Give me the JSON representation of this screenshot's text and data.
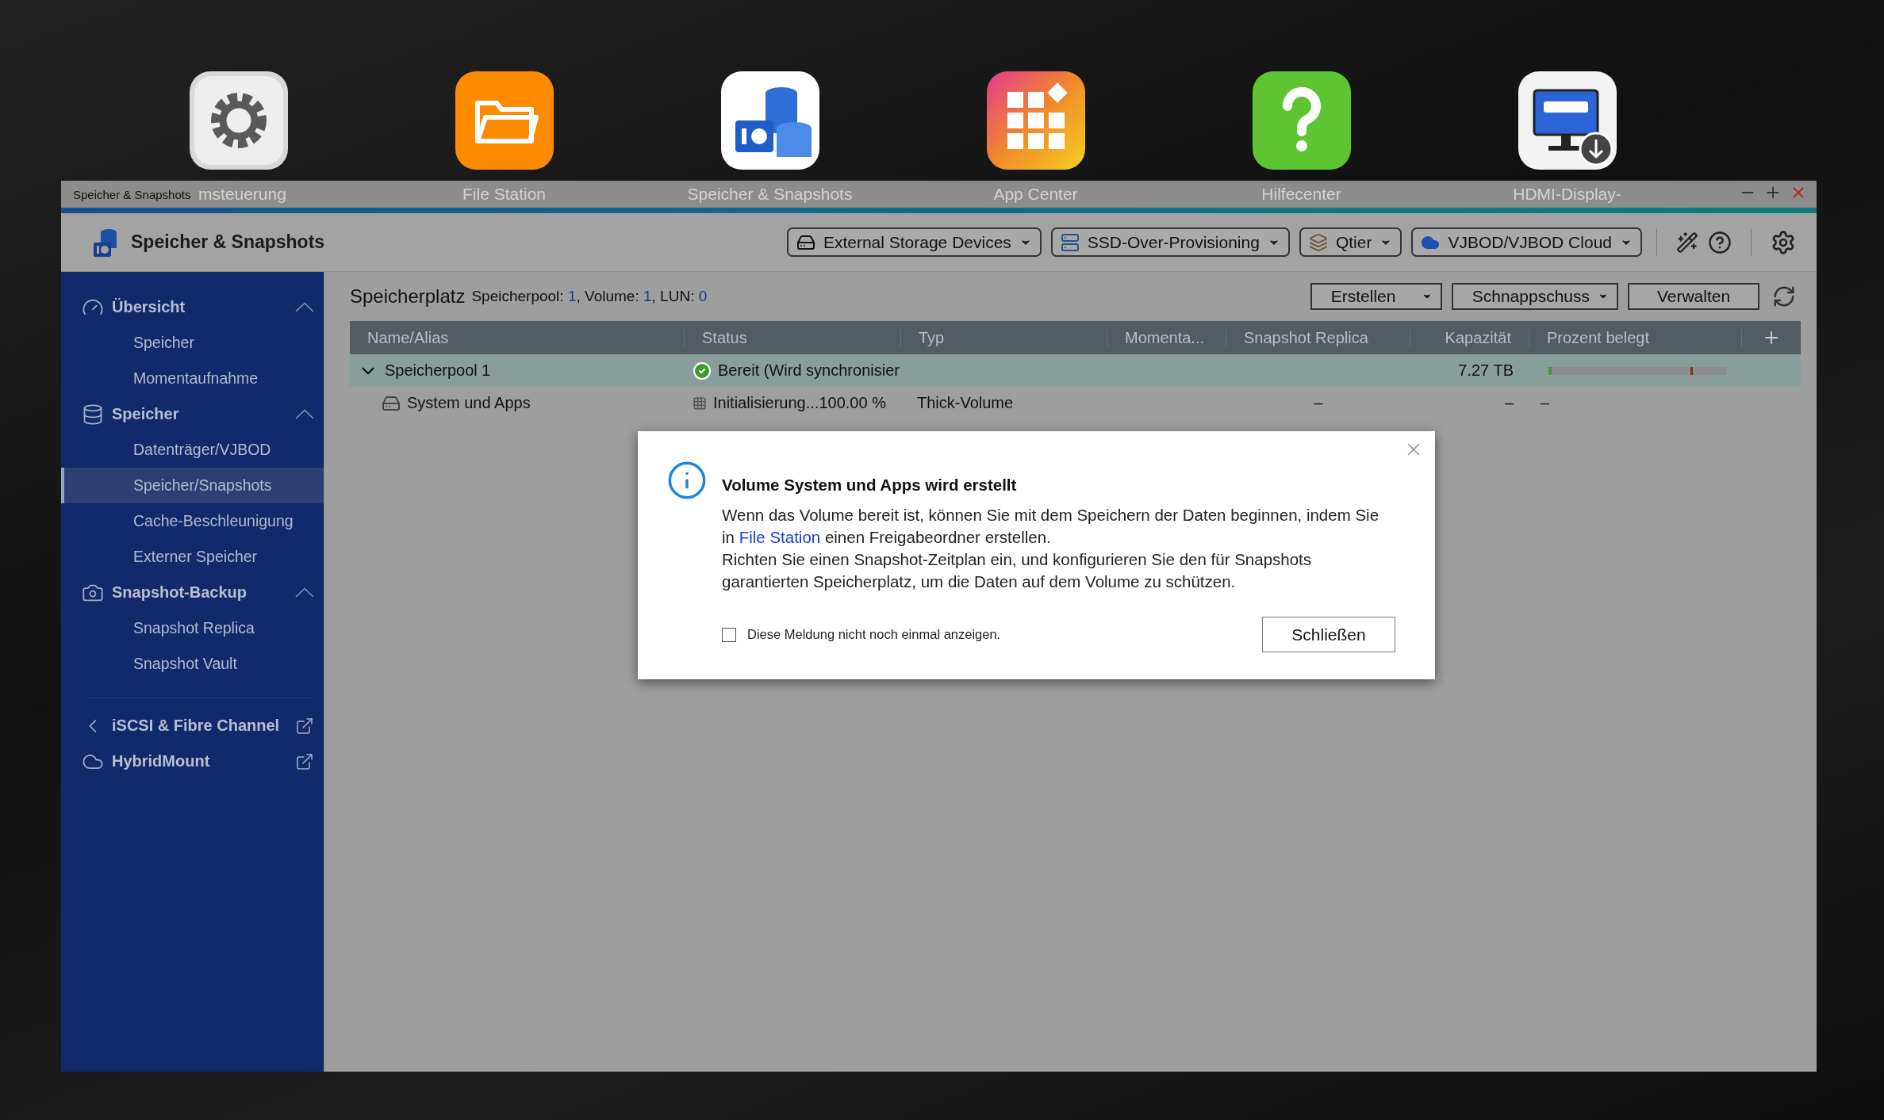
{
  "desktop": {
    "icons": [
      {
        "kind": "settings",
        "label": "msteuerung"
      },
      {
        "kind": "folder",
        "label": "File Station"
      },
      {
        "kind": "storage",
        "label": "Speicher & Snapshots"
      },
      {
        "kind": "apps",
        "label": "App Center"
      },
      {
        "kind": "help",
        "label": "Hilfecenter"
      },
      {
        "kind": "hdmi",
        "label": "HDMI-Display-"
      }
    ]
  },
  "window": {
    "title": "Speicher & Snapshots",
    "app_name": "Speicher & Snapshots",
    "toolbar": [
      {
        "kind": "disk",
        "label": "External Storage Devices"
      },
      {
        "kind": "ssd",
        "label": "SSD-Over-Provisioning"
      },
      {
        "kind": "tier",
        "label": "Qtier"
      },
      {
        "kind": "cloud",
        "label": "VJBOD/VJBOD Cloud"
      }
    ]
  },
  "sidebar": {
    "groups": [
      {
        "kind": "gauge",
        "label": "Übersicht",
        "expanded": true,
        "items": [
          {
            "label": "Speicher",
            "selected": false
          },
          {
            "label": "Momentaufnahme",
            "selected": false
          }
        ]
      },
      {
        "kind": "database",
        "label": "Speicher",
        "expanded": true,
        "items": [
          {
            "label": "Datenträger/VJBOD",
            "selected": false
          },
          {
            "label": "Speicher/Snapshots",
            "selected": true
          },
          {
            "label": "Cache-Beschleunigung",
            "selected": false
          },
          {
            "label": "Externer Speicher",
            "selected": false
          }
        ]
      },
      {
        "kind": "camera",
        "label": "Snapshot-Backup",
        "expanded": true,
        "items": [
          {
            "label": "Snapshot Replica",
            "selected": false
          },
          {
            "label": "Snapshot Vault",
            "selected": false
          }
        ]
      }
    ],
    "links": [
      {
        "kind": "iscsi",
        "label": "iSCSI & Fibre Channel"
      },
      {
        "kind": "hybrid",
        "label": "HybridMount"
      }
    ]
  },
  "content": {
    "title": "Speicherplatz",
    "summary": [
      {
        "label": "Speicherpool:",
        "value": "1"
      },
      {
        "label": ", Volume:",
        "value": "1"
      },
      {
        "label": ", LUN:",
        "value": "0"
      }
    ],
    "actions": [
      {
        "label": "Erstellen",
        "dropdown": true
      },
      {
        "label": "Schnappschuss",
        "dropdown": true
      },
      {
        "label": "Verwalten",
        "dropdown": false
      }
    ],
    "table": {
      "columns": [
        "Name/Alias",
        "Status",
        "Typ",
        "Momenta...",
        "Snapshot Replica",
        "Kapazität",
        "Prozent belegt"
      ],
      "rows": [
        {
          "kind": "pool",
          "expanded": true,
          "selected": true,
          "name": "Speicherpool 1",
          "status": "Bereit (Wird synchronisier",
          "type": "",
          "replica": "",
          "capacity": "7.27 TB",
          "level": 0.02
        },
        {
          "kind": "volume",
          "selected": false,
          "name": "System und Apps",
          "status": "Initialisierung...100.00 %",
          "type": "Thick-Volume",
          "replica": "–",
          "capacity": "–",
          "percent": "–"
        }
      ]
    }
  },
  "dialog": {
    "title": "Volume System und Apps wird erstellt",
    "paragraphs": [
      {
        "before": "Wenn das Volume bereit ist, können Sie mit dem Speichern der Daten beginnen, indem Sie in ",
        "link": "File Station",
        "after": " einen Freigabeordner erstellen."
      },
      {
        "before": "Richten Sie einen Snapshot-Zeitplan ein, und konfigurieren Sie den für Snapshots garantierten Speicherplatz, um die Daten auf dem Volume zu schützen."
      }
    ],
    "checkbox": {
      "label": "Diese Meldung nicht noch einmal anzeigen.",
      "checked": false
    },
    "button": "Schließen"
  }
}
